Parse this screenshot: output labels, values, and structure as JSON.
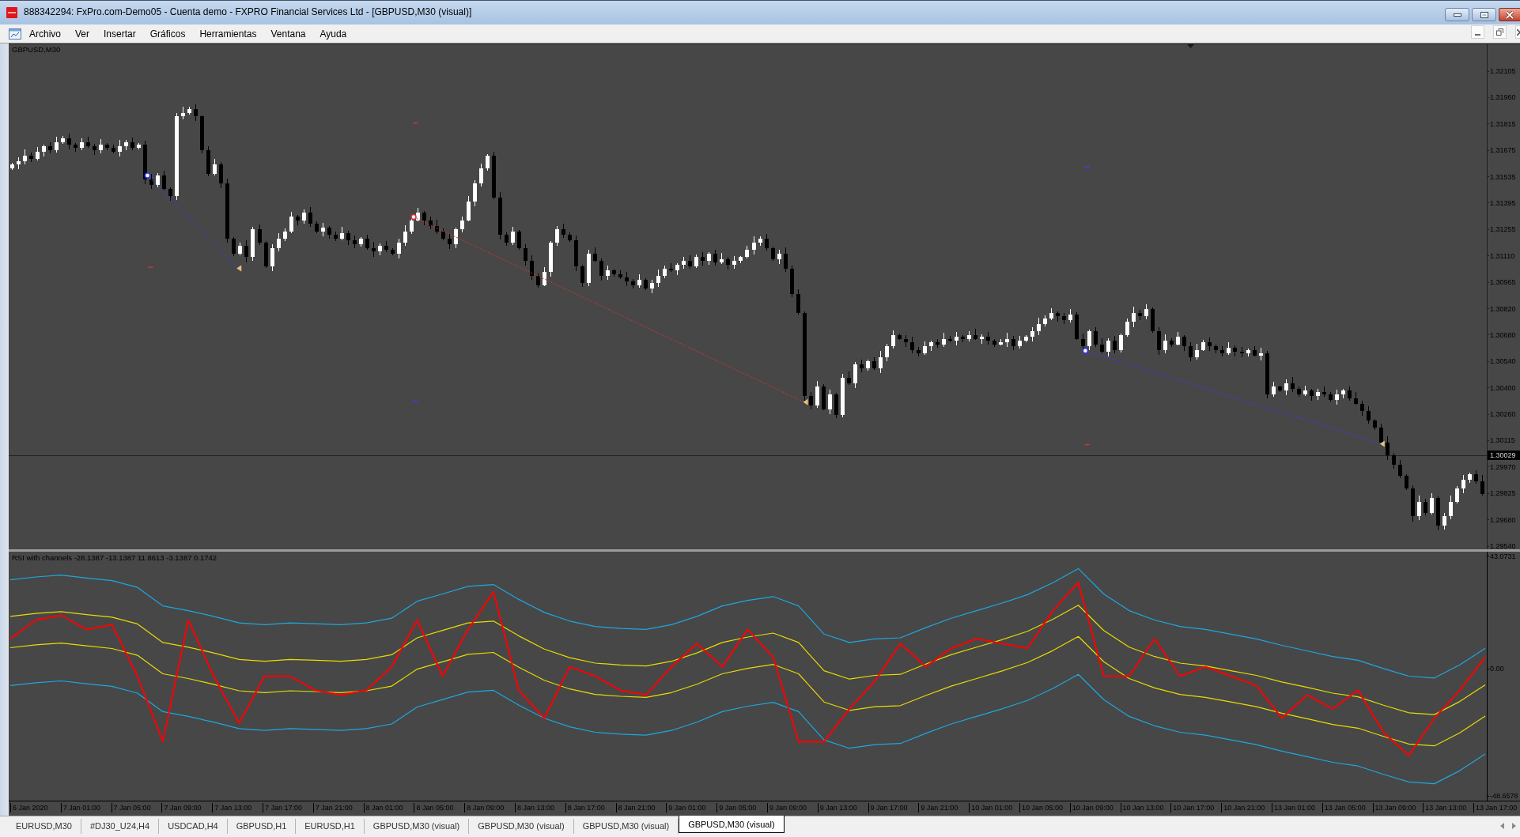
{
  "window": {
    "title": "888342294: FxPro.com-Demo05 - Cuenta demo - FXPRO Financial Services Ltd - [GBPUSD,M30 (visual)]"
  },
  "menu": [
    "Archivo",
    "Ver",
    "Insertar",
    "Gráficos",
    "Herramientas",
    "Ventana",
    "Ayuda"
  ],
  "chart": {
    "title": "GBPUSD,M30",
    "price_axis": [
      "1.32105",
      "1.31960",
      "1.31815",
      "1.31675",
      "1.31535",
      "1.31395",
      "1.31255",
      "1.31110",
      "1.30965",
      "1.30820",
      "1.30680",
      "1.30540",
      "1.30400",
      "1.30260",
      "1.30115",
      "1.29970",
      "1.29825",
      "1.29680",
      "1.29540"
    ],
    "current_price": "1.30029"
  },
  "indicator": {
    "header": "RSI with channels -28.1387 -13.1387 11.8613 -3.1387 0.1742",
    "chart_data": {
      "type": "line",
      "ylim": [
        -50.47,
        44.88
      ],
      "yticks": [
        {
          "value": 43.0731,
          "label": "43.0731"
        },
        {
          "value": 0,
          "label": "0.00"
        },
        {
          "value": -48.6578,
          "label": "-48.6578"
        }
      ],
      "series": [
        {
          "color": "#1ea7e0",
          "values": [
            34.1,
            35.2,
            35.9,
            34.8,
            33.8,
            31.2,
            24.1,
            22.3,
            20.1,
            17.6,
            16.9,
            17.6,
            17.3,
            16.9,
            17.6,
            19.4,
            25.9,
            28.7,
            31.6,
            32.3,
            26.6,
            21.6,
            18.3,
            16.2,
            15.5,
            15.1,
            16.9,
            20.1,
            24.1,
            26.2,
            27.7,
            24.1,
            13.3,
            10.1,
            11.5,
            11.9,
            15.8,
            19.4,
            22.3,
            25.2,
            28.4,
            33.0,
            38.4,
            28.7,
            22.3,
            18.7,
            16.2,
            15.1,
            13.3,
            11.5,
            9.0,
            6.9,
            4.7,
            3.3,
            0.1,
            -2.8,
            -3.5,
            1.5,
            7.9
          ]
        },
        {
          "color": "#e8dc00",
          "values": [
            20.1,
            21.2,
            21.9,
            20.8,
            19.8,
            17.2,
            10.1,
            8.3,
            6.1,
            3.6,
            2.9,
            3.6,
            3.3,
            2.9,
            3.6,
            5.4,
            11.9,
            14.7,
            17.6,
            18.3,
            12.6,
            7.6,
            4.3,
            2.2,
            1.5,
            1.1,
            2.9,
            6.1,
            10.1,
            12.2,
            13.7,
            10.1,
            -0.7,
            -3.9,
            -2.5,
            -2.1,
            1.8,
            5.4,
            8.3,
            11.2,
            14.4,
            19.0,
            24.4,
            14.7,
            8.3,
            4.7,
            2.2,
            1.1,
            -0.7,
            -2.5,
            -5.0,
            -7.1,
            -9.3,
            -10.7,
            -13.9,
            -16.8,
            -17.5,
            -12.5,
            -6.1
          ]
        },
        {
          "color": "#e8dc00",
          "values": [
            8.1,
            9.2,
            9.9,
            8.8,
            7.8,
            5.2,
            -1.9,
            -3.7,
            -5.9,
            -8.4,
            -9.1,
            -8.4,
            -8.7,
            -9.1,
            -8.4,
            -6.6,
            -0.1,
            2.7,
            5.6,
            6.3,
            0.6,
            -4.4,
            -7.7,
            -9.8,
            -10.5,
            -10.9,
            -9.1,
            -5.9,
            -1.9,
            0.2,
            1.7,
            -1.9,
            -12.7,
            -15.9,
            -14.5,
            -14.1,
            -10.2,
            -6.6,
            -3.7,
            -0.8,
            2.4,
            7.0,
            12.4,
            2.7,
            -3.7,
            -7.3,
            -9.8,
            -10.9,
            -12.7,
            -14.5,
            -17.0,
            -19.1,
            -21.3,
            -22.7,
            -25.9,
            -28.8,
            -29.5,
            -24.5,
            -18.1
          ]
        },
        {
          "color": "#1ea7e0",
          "values": [
            -6.4,
            -5.3,
            -4.6,
            -5.7,
            -6.7,
            -9.3,
            -16.4,
            -18.2,
            -20.4,
            -22.9,
            -23.6,
            -22.9,
            -23.2,
            -23.6,
            -22.9,
            -21.1,
            -14.6,
            -11.8,
            -8.9,
            -8.2,
            -13.9,
            -18.9,
            -22.2,
            -24.3,
            -25.0,
            -25.4,
            -23.6,
            -20.4,
            -16.4,
            -14.3,
            -12.8,
            -16.4,
            -27.2,
            -30.4,
            -29.0,
            -28.6,
            -24.7,
            -21.1,
            -18.2,
            -15.3,
            -12.1,
            -7.5,
            -2.1,
            -11.8,
            -18.2,
            -21.8,
            -24.3,
            -25.4,
            -27.2,
            -29.0,
            -31.5,
            -33.6,
            -35.8,
            -37.2,
            -40.4,
            -43.3,
            -44.0,
            -39.0,
            -32.6
          ]
        },
        {
          "color": "#ff0000",
          "values": [
            11.5,
            18.7,
            20.5,
            15.1,
            16.9,
            -2.8,
            -27.9,
            18.7,
            -2.8,
            -20.7,
            -2.8,
            -2.8,
            -8.2,
            -10.0,
            -8.2,
            0.8,
            18.7,
            -2.8,
            15.1,
            29.5,
            -8.2,
            -18.9,
            0.8,
            -2.8,
            -8.2,
            -10.0,
            0.8,
            9.7,
            0.8,
            15.1,
            4.4,
            -27.9,
            -27.9,
            -15.3,
            -4.6,
            9.7,
            0.8,
            7.9,
            11.5,
            9.7,
            7.9,
            22.3,
            33.0,
            -2.8,
            -2.8,
            11.5,
            -2.8,
            0.8,
            -2.8,
            -6.4,
            -18.9,
            -10.0,
            -15.3,
            -8.2,
            -24.3,
            -33.2,
            -18.9,
            -8.2,
            4.4
          ]
        }
      ]
    }
  },
  "time_axis": {
    "labels": [
      "6 Jan 2020",
      "7 Jan 01:00",
      "7 Jan 05:00",
      "7 Jan 09:00",
      "7 Jan 13:00",
      "7 Jan 17:00",
      "7 Jan 21:00",
      "8 Jan 01:00",
      "8 Jan 05:00",
      "8 Jan 09:00",
      "8 Jan 13:00",
      "8 Jan 17:00",
      "8 Jan 21:00",
      "9 Jan 01:00",
      "9 Jan 05:00",
      "9 Jan 09:00",
      "9 Jan 13:00",
      "9 Jan 17:00",
      "9 Jan 21:00",
      "10 Jan 01:00",
      "10 Jan 05:00",
      "10 Jan 09:00",
      "10 Jan 13:00",
      "10 Jan 17:00",
      "10 Jan 21:00",
      "13 Jan 01:00",
      "13 Jan 05:00",
      "13 Jan 09:00",
      "13 Jan 13:00",
      "13 Jan 17:00"
    ]
  },
  "tabs": [
    {
      "label": "EURUSD,M30",
      "selected": false
    },
    {
      "label": "#DJ30_U24,H4",
      "selected": false
    },
    {
      "label": "USDCAD,H4",
      "selected": false
    },
    {
      "label": "GBPUSD,H1",
      "selected": false
    },
    {
      "label": "EURUSD,H1",
      "selected": false
    },
    {
      "label": "GBPUSD,M30 (visual)",
      "selected": false
    },
    {
      "label": "GBPUSD,M30 (visual)",
      "selected": false
    },
    {
      "label": "GBPUSD,M30 (visual)",
      "selected": false
    },
    {
      "label": "GBPUSD,M30 (visual)",
      "selected": true
    }
  ]
}
